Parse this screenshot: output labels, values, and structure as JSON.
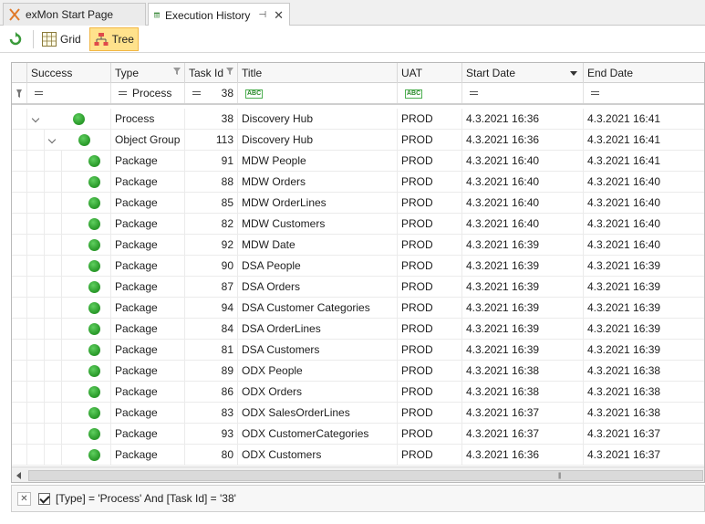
{
  "tabs": [
    {
      "label": "exMon Start Page",
      "icon": "exmon-x-icon",
      "active": false
    },
    {
      "label": "Execution History",
      "icon": "table-icon",
      "active": true
    }
  ],
  "toolbar": {
    "grid_label": "Grid",
    "tree_label": "Tree",
    "active_view": "Tree"
  },
  "columns": [
    {
      "key": "success",
      "label": "Success"
    },
    {
      "key": "type",
      "label": "Type"
    },
    {
      "key": "task_id",
      "label": "Task Id"
    },
    {
      "key": "title",
      "label": "Title"
    },
    {
      "key": "uat",
      "label": "UAT"
    },
    {
      "key": "start_date",
      "label": "Start Date"
    },
    {
      "key": "end_date",
      "label": "End Date"
    }
  ],
  "filter_row": {
    "type": "Process",
    "task_id": "38"
  },
  "rows": [
    {
      "level": 0,
      "expanded": true,
      "type": "Process",
      "task_id": "38",
      "title": "Discovery Hub",
      "uat": "PROD",
      "start_date": "4.3.2021 16:36",
      "end_date": "4.3.2021 16:41"
    },
    {
      "level": 1,
      "expanded": true,
      "type": "Object Group",
      "task_id": "113",
      "title": "Discovery Hub",
      "uat": "PROD",
      "start_date": "4.3.2021 16:36",
      "end_date": "4.3.2021 16:41"
    },
    {
      "level": 2,
      "type": "Package",
      "task_id": "91",
      "title": "MDW People",
      "uat": "PROD",
      "start_date": "4.3.2021 16:40",
      "end_date": "4.3.2021 16:41"
    },
    {
      "level": 2,
      "type": "Package",
      "task_id": "88",
      "title": "MDW Orders",
      "uat": "PROD",
      "start_date": "4.3.2021 16:40",
      "end_date": "4.3.2021 16:40"
    },
    {
      "level": 2,
      "type": "Package",
      "task_id": "85",
      "title": "MDW OrderLines",
      "uat": "PROD",
      "start_date": "4.3.2021 16:40",
      "end_date": "4.3.2021 16:40"
    },
    {
      "level": 2,
      "type": "Package",
      "task_id": "82",
      "title": "MDW Customers",
      "uat": "PROD",
      "start_date": "4.3.2021 16:40",
      "end_date": "4.3.2021 16:40"
    },
    {
      "level": 2,
      "type": "Package",
      "task_id": "92",
      "title": "MDW Date",
      "uat": "PROD",
      "start_date": "4.3.2021 16:39",
      "end_date": "4.3.2021 16:40"
    },
    {
      "level": 2,
      "type": "Package",
      "task_id": "90",
      "title": "DSA People",
      "uat": "PROD",
      "start_date": "4.3.2021 16:39",
      "end_date": "4.3.2021 16:39"
    },
    {
      "level": 2,
      "type": "Package",
      "task_id": "87",
      "title": "DSA Orders",
      "uat": "PROD",
      "start_date": "4.3.2021 16:39",
      "end_date": "4.3.2021 16:39"
    },
    {
      "level": 2,
      "type": "Package",
      "task_id": "94",
      "title": "DSA Customer Categories",
      "uat": "PROD",
      "start_date": "4.3.2021 16:39",
      "end_date": "4.3.2021 16:39"
    },
    {
      "level": 2,
      "type": "Package",
      "task_id": "84",
      "title": "DSA OrderLines",
      "uat": "PROD",
      "start_date": "4.3.2021 16:39",
      "end_date": "4.3.2021 16:39"
    },
    {
      "level": 2,
      "type": "Package",
      "task_id": "81",
      "title": "DSA Customers",
      "uat": "PROD",
      "start_date": "4.3.2021 16:39",
      "end_date": "4.3.2021 16:39"
    },
    {
      "level": 2,
      "type": "Package",
      "task_id": "89",
      "title": "ODX People",
      "uat": "PROD",
      "start_date": "4.3.2021 16:38",
      "end_date": "4.3.2021 16:38"
    },
    {
      "level": 2,
      "type": "Package",
      "task_id": "86",
      "title": "ODX Orders",
      "uat": "PROD",
      "start_date": "4.3.2021 16:38",
      "end_date": "4.3.2021 16:38"
    },
    {
      "level": 2,
      "type": "Package",
      "task_id": "83",
      "title": "ODX SalesOrderLines",
      "uat": "PROD",
      "start_date": "4.3.2021 16:37",
      "end_date": "4.3.2021 16:38"
    },
    {
      "level": 2,
      "type": "Package",
      "task_id": "93",
      "title": "ODX CustomerCategories",
      "uat": "PROD",
      "start_date": "4.3.2021 16:37",
      "end_date": "4.3.2021 16:37"
    },
    {
      "level": 2,
      "type": "Package",
      "task_id": "80",
      "title": "ODX Customers",
      "uat": "PROD",
      "start_date": "4.3.2021 16:36",
      "end_date": "4.3.2021 16:37"
    }
  ],
  "filter_panel": {
    "expression": "[Type] = 'Process' And [Task Id] = '38'",
    "enabled": true
  },
  "colors": {
    "success_green": "#2e9e2e",
    "active_button": "#ffe28c"
  }
}
